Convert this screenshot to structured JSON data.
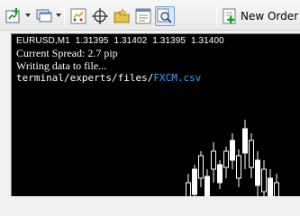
{
  "toolbar": {
    "buttons": [
      {
        "icon": "new-chart-icon",
        "has_dropdown": true
      },
      {
        "icon": "profiles-icon",
        "has_dropdown": true
      },
      {
        "icon": "market-watch-icon"
      },
      {
        "icon": "crosshair-icon"
      },
      {
        "icon": "favorites-folder-icon"
      },
      {
        "icon": "terminal-icon"
      },
      {
        "icon": "zoom-strategy-tester-icon",
        "active": true
      }
    ],
    "new_order_label": "New Order",
    "new_order_icon": "new-order-icon"
  },
  "chart": {
    "header": {
      "symbol_period": "EURUSD,M1",
      "open": "1.31395",
      "high": "1.31402",
      "low": "1.31395",
      "close": "1.31400"
    },
    "comment": {
      "spread_line": "Current Spread: 2.7 pip",
      "status_line": "Writing data to file...",
      "path_prefix": "terminal/experts/files/",
      "file_name": "FXCM.csv"
    },
    "colors": {
      "background": "#000000",
      "candle": "#ffffff",
      "text": "#ffffff",
      "file_name": "#3da3ff"
    }
  }
}
